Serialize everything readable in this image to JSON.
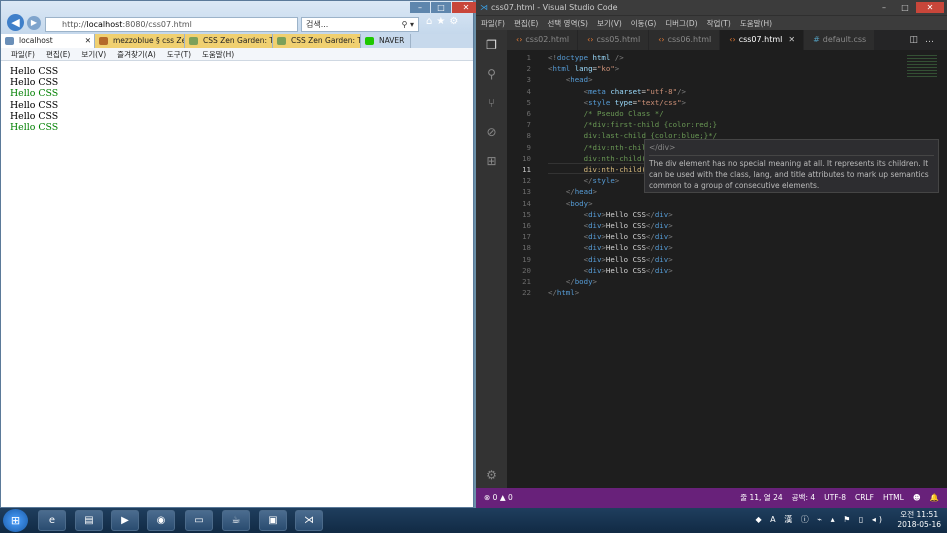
{
  "ie": {
    "address_prefix": "http://",
    "address_domain": "localhost",
    "address_rest": ":8080/css07.html",
    "search_placeholder": "검색...",
    "tabs": [
      "localhost",
      "mezzoblue § css Zen...",
      "CSS Zen Garden: The...",
      "CSS Zen Garden: The...",
      "NAVER"
    ],
    "menu": [
      "파일(F)",
      "편집(E)",
      "보기(V)",
      "즐겨찾기(A)",
      "도구(T)",
      "도움말(H)"
    ],
    "content": [
      {
        "text": "Hello CSS",
        "color": "#000000"
      },
      {
        "text": "Hello CSS",
        "color": "#000000"
      },
      {
        "text": "Hello CSS",
        "color": "#008000"
      },
      {
        "text": "Hello CSS",
        "color": "#000000"
      },
      {
        "text": "Hello CSS",
        "color": "#000000"
      },
      {
        "text": "Hello CSS",
        "color": "#008000"
      }
    ]
  },
  "vscode": {
    "title": "css07.html - Visual Studio Code",
    "menu": [
      "파일(F)",
      "편집(E)",
      "선택 영역(S)",
      "보기(V)",
      "이동(G)",
      "디버그(D)",
      "작업(T)",
      "도움말(H)"
    ],
    "tabs": [
      "css02.html",
      "css05.html",
      "css06.html",
      "css07.html",
      "default.css"
    ],
    "active_tab": "css07.html",
    "hover": {
      "tag": "</div>",
      "text": "The div element has no special meaning at all. It represents its children. It can be used with the class, lang, and title attributes to mark up semantics common to a group of consecutive elements."
    },
    "status": {
      "errors": "⊗ 0",
      "warnings": "▲ 0",
      "position": "줄 11, 열 24",
      "spaces": "공백: 4",
      "encoding": "UTF-8",
      "eol": "CRLF",
      "language": "HTML",
      "smiley": "☻",
      "bell": "🔔"
    }
  },
  "taskbar": {
    "time": "오전 11:51",
    "date": "2018-05-16"
  }
}
